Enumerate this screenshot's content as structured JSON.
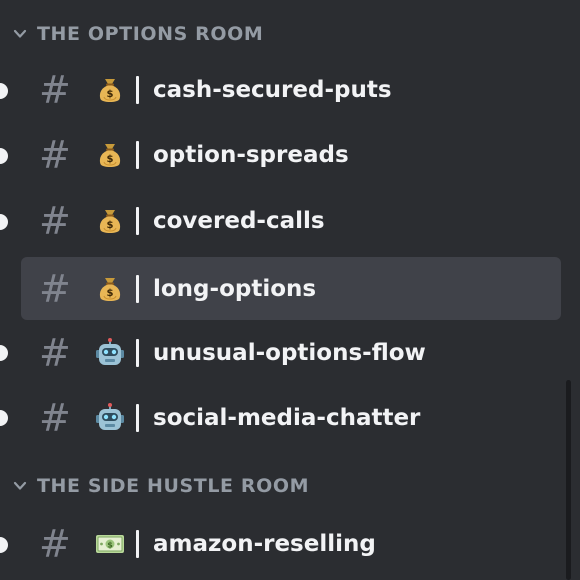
{
  "categories": [
    {
      "label": "THE OPTIONS ROOM"
    },
    {
      "label": "THE SIDE HUSTLE ROOM"
    }
  ],
  "channels": [
    {
      "prefix": "#",
      "emoji": "money-bag-icon",
      "separator": "|",
      "name": "cash-secured-puts",
      "unread": true,
      "selected": false
    },
    {
      "prefix": "#",
      "emoji": "money-bag-icon",
      "separator": "|",
      "name": "option-spreads",
      "unread": true,
      "selected": false
    },
    {
      "prefix": "#",
      "emoji": "money-bag-icon",
      "separator": "|",
      "name": "covered-calls",
      "unread": true,
      "selected": false
    },
    {
      "prefix": "#",
      "emoji": "money-bag-icon",
      "separator": "|",
      "name": "long-options",
      "unread": false,
      "selected": true
    },
    {
      "prefix": "#",
      "emoji": "robot-face-icon",
      "separator": "|",
      "name": "unusual-options-flow",
      "unread": true,
      "selected": false
    },
    {
      "prefix": "#",
      "emoji": "robot-face-icon",
      "separator": "|",
      "name": "social-media-chatter",
      "unread": true,
      "selected": false
    },
    {
      "prefix": "#",
      "emoji": "dollar-banknote-icon",
      "separator": "|",
      "name": "amazon-reselling",
      "unread": true,
      "selected": false
    }
  ],
  "colors": {
    "background": "#2b2d31",
    "selected_row": "#404249",
    "channel_text": "#f2f3f5",
    "muted_text": "#949ba4"
  }
}
